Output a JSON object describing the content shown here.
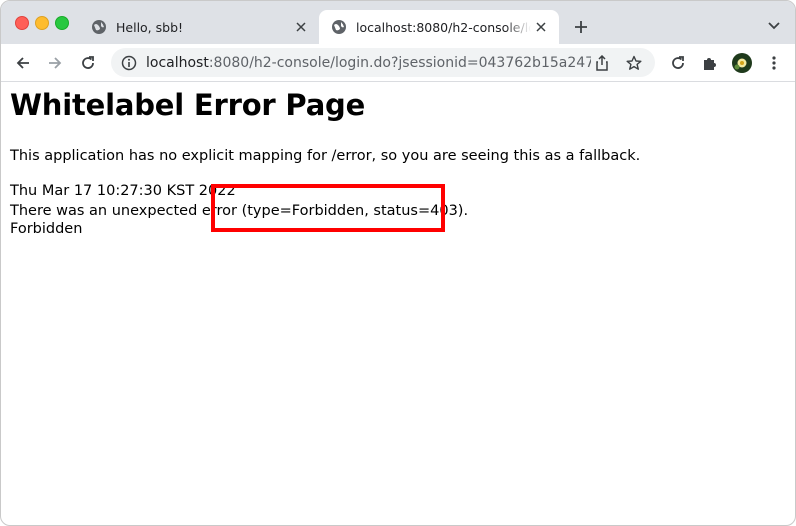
{
  "browser": {
    "tabs": [
      {
        "title": "Hello, sbb!",
        "active": false
      },
      {
        "title": "localhost:8080/h2-console/login.do?jsessionid=043762b15a247",
        "active": true
      }
    ],
    "url": {
      "host": "localhost",
      "path": ":8080/h2-console/login.do?jsessionid=043762b15a247..."
    },
    "icons": {
      "back": "arrow-left-icon",
      "forward": "arrow-right-icon",
      "reload": "reload-icon",
      "info": "info-icon",
      "share": "share-icon",
      "bookmark": "star-icon",
      "extensions": "puzzle-icon",
      "menu": "kebab-menu-icon"
    }
  },
  "page": {
    "title": "Whitelabel Error Page",
    "message": "This application has no explicit mapping for /error, so you are seeing this as a fallback.",
    "timestamp": "Thu Mar 17 10:27:30 KST 2022",
    "error_line": "There was an unexpected error (type=Forbidden, status=403).",
    "detail": "Forbidden"
  },
  "annotation": {
    "highlight_color": "#ff0000"
  }
}
